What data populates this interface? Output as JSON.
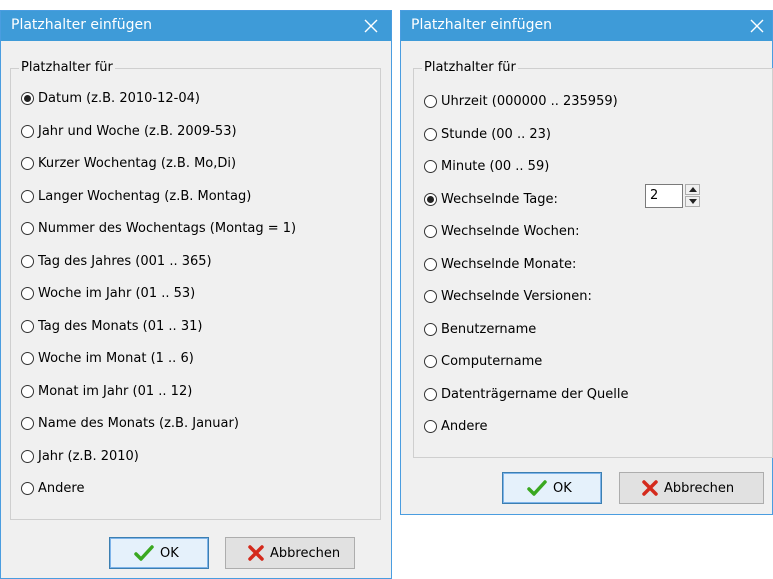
{
  "dialog_left": {
    "title": "Platzhalter einfügen",
    "group_label": "Platzhalter für",
    "options": [
      {
        "label": "Datum (z.B. 2010-12-04)",
        "selected": true
      },
      {
        "label": "Jahr und Woche (z.B. 2009-53)",
        "selected": false
      },
      {
        "label": "Kurzer Wochentag (z.B. Mo,Di)",
        "selected": false
      },
      {
        "label": "Langer Wochentag (z.B. Montag)",
        "selected": false
      },
      {
        "label": "Nummer des Wochentags (Montag = 1)",
        "selected": false
      },
      {
        "label": "Tag des Jahres (001 .. 365)",
        "selected": false
      },
      {
        "label": "Woche im Jahr (01 .. 53)",
        "selected": false
      },
      {
        "label": "Tag des Monats (01 .. 31)",
        "selected": false
      },
      {
        "label": "Woche im Monat (1 .. 6)",
        "selected": false
      },
      {
        "label": "Monat im Jahr (01 .. 12)",
        "selected": false
      },
      {
        "label": "Name des Monats (z.B. Januar)",
        "selected": false
      },
      {
        "label": "Jahr (z.B. 2010)",
        "selected": false
      },
      {
        "label": "Andere",
        "selected": false
      }
    ],
    "ok_label": "OK",
    "cancel_label": "Abbrechen"
  },
  "dialog_right": {
    "title": "Platzhalter einfügen",
    "group_label": "Platzhalter für",
    "options": [
      {
        "label": "Uhrzeit (000000 .. 235959)",
        "selected": false
      },
      {
        "label": "Stunde (00 .. 23)",
        "selected": false
      },
      {
        "label": "Minute (00 .. 59)",
        "selected": false
      },
      {
        "label": "Wechselnde Tage:",
        "selected": true
      },
      {
        "label": "Wechselnde Wochen:",
        "selected": false
      },
      {
        "label": "Wechselnde Monate:",
        "selected": false
      },
      {
        "label": "Wechselnde Versionen:",
        "selected": false
      },
      {
        "label": "Benutzername",
        "selected": false
      },
      {
        "label": "Computername",
        "selected": false
      },
      {
        "label": "Datenträgername der Quelle",
        "selected": false
      },
      {
        "label": "Andere",
        "selected": false
      }
    ],
    "days_value": "2",
    "ok_label": "OK",
    "cancel_label": "Abbrechen"
  },
  "colors": {
    "titlebar": "#3e9bd8",
    "ok_check": "#3aa820",
    "cancel_x": "#d42a1c"
  }
}
